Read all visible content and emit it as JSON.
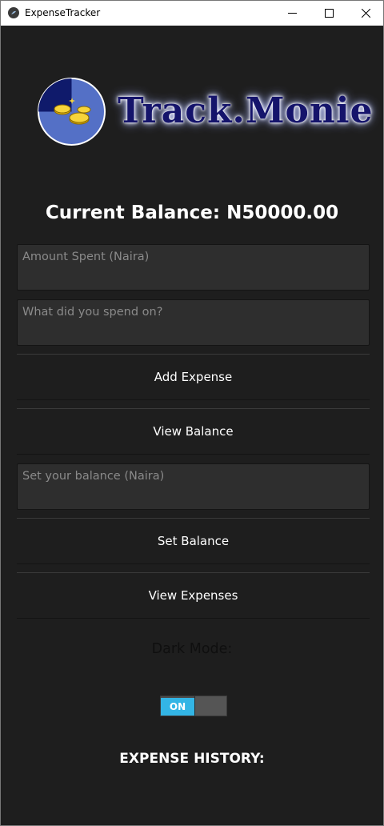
{
  "window": {
    "title": "ExpenseTracker"
  },
  "logo": {
    "text": "Track.Monie"
  },
  "balance": {
    "label": "Current Balance: N50000.00"
  },
  "inputs": {
    "amount_placeholder": "Amount Spent (Naira)",
    "description_placeholder": "What did you spend on?",
    "set_balance_placeholder": "Set your balance (Naira)"
  },
  "buttons": {
    "add_expense": "Add Expense",
    "view_balance": "View Balance",
    "set_balance": "Set Balance",
    "view_expenses": "View Expenses"
  },
  "dark_mode": {
    "label": "Dark Mode:",
    "toggle_state": "ON"
  },
  "history": {
    "label": "EXPENSE HISTORY:"
  },
  "colors": {
    "background": "#1e1e1e",
    "toggle_accent": "#33b5e5",
    "logo_navy": "#15146b"
  }
}
